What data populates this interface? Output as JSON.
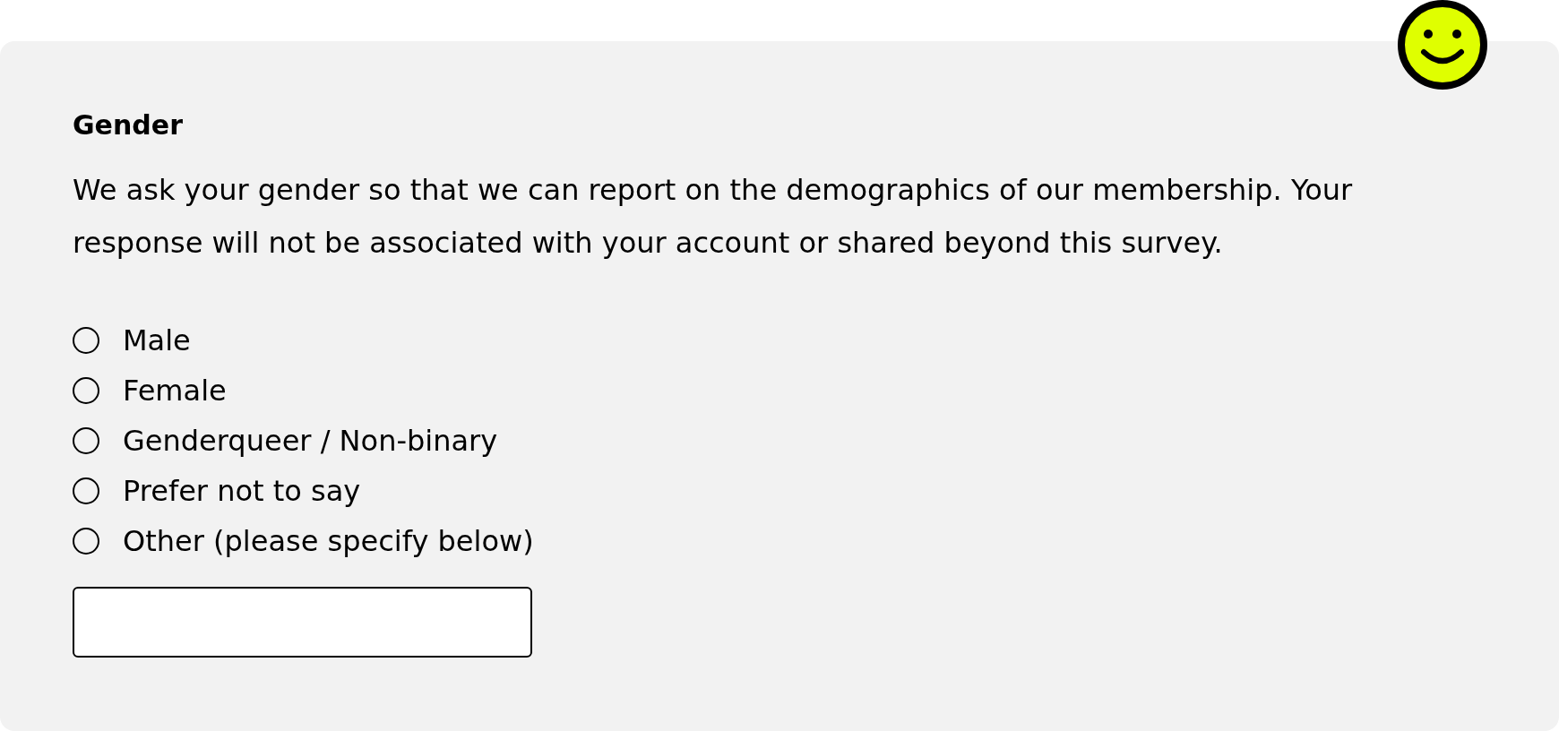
{
  "question": {
    "title": "Gender",
    "description": "We ask your gender so that we can report on the demographics of our membership. Your response will not be associated with your account or shared beyond this survey."
  },
  "options": [
    {
      "label": "Male",
      "selected": false
    },
    {
      "label": "Female",
      "selected": false
    },
    {
      "label": "Genderqueer / Non-binary",
      "selected": false
    },
    {
      "label": "Prefer not to say",
      "selected": false
    },
    {
      "label": "Other (please specify below)",
      "selected": false
    }
  ]
}
